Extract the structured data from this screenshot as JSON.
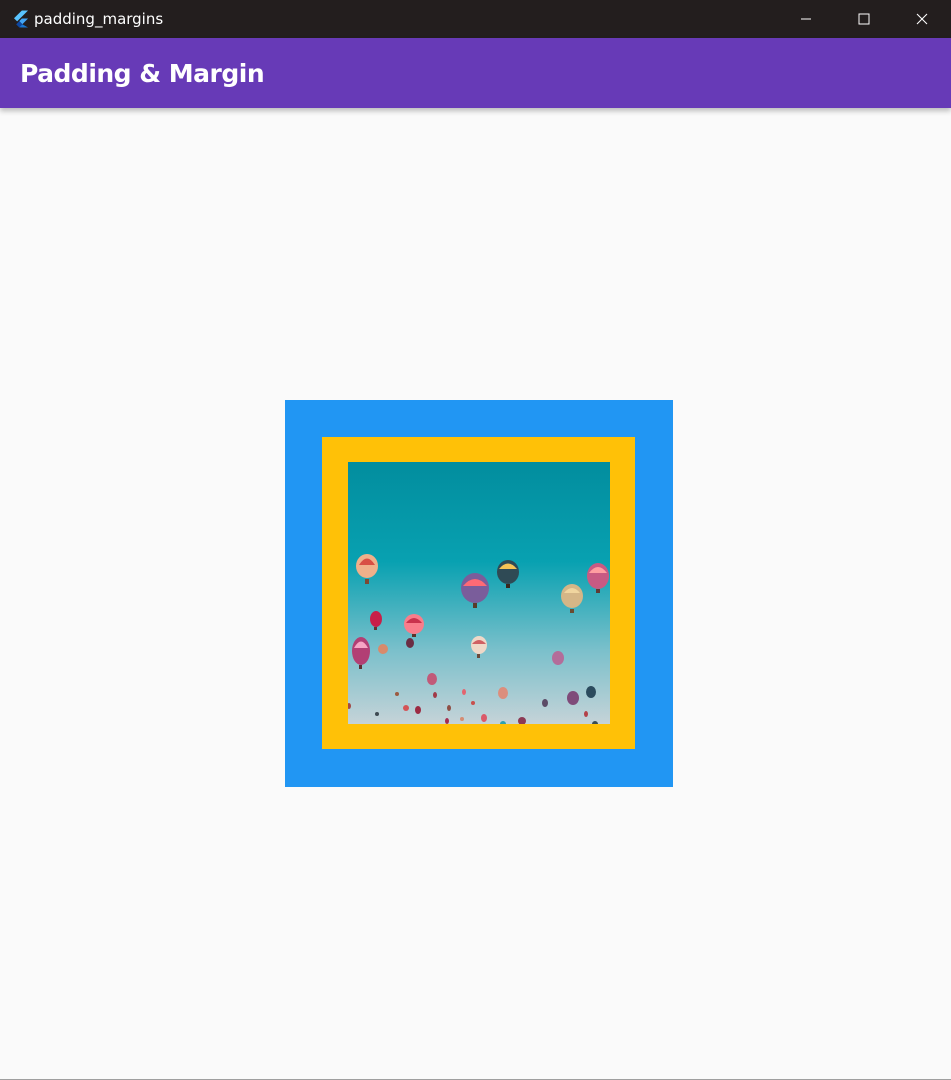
{
  "window": {
    "title": "padding_margins",
    "app_icon": "flutter-logo-icon",
    "controls": [
      "minimize-icon",
      "maximize-icon",
      "close-icon"
    ]
  },
  "appbar": {
    "title": "Padding & Margin"
  },
  "content": {
    "image_description_icon": "hot-air-balloons-image"
  },
  "colors": {
    "titlebar": "#231e1e",
    "appbar": "#673ab7",
    "background": "#fafafa",
    "outer_container": "#2196f3",
    "inner_container": "#ffc107"
  }
}
